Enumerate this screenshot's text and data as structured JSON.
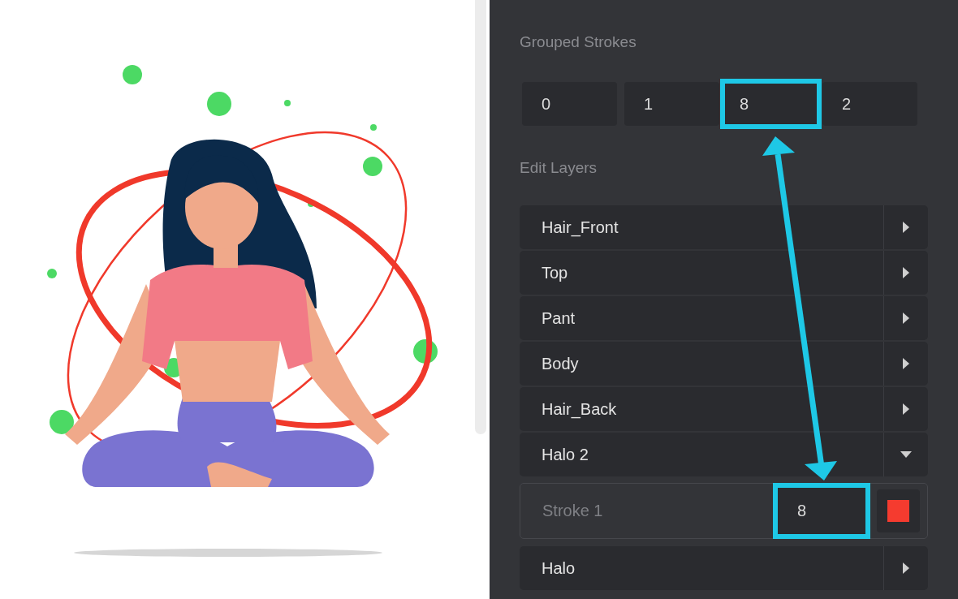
{
  "grouped_strokes": {
    "title": "Grouped Strokes",
    "fields": [
      {
        "value": "0",
        "highlighted": false
      },
      {
        "value": "1",
        "highlighted": false
      },
      {
        "value": "8",
        "highlighted": true
      },
      {
        "value": "2",
        "highlighted": false
      }
    ]
  },
  "edit_layers": {
    "title": "Edit Layers",
    "layers": [
      {
        "name": "Hair_Front",
        "expanded": false
      },
      {
        "name": "Top",
        "expanded": false
      },
      {
        "name": "Pant",
        "expanded": false
      },
      {
        "name": "Body",
        "expanded": false
      },
      {
        "name": "Hair_Back",
        "expanded": false
      },
      {
        "name": "Halo 2",
        "expanded": true,
        "strokes": [
          {
            "name": "Stroke 1",
            "value": "8",
            "color": "#f53b2f",
            "highlighted": true
          }
        ]
      },
      {
        "name": "Halo",
        "expanded": false
      }
    ]
  }
}
